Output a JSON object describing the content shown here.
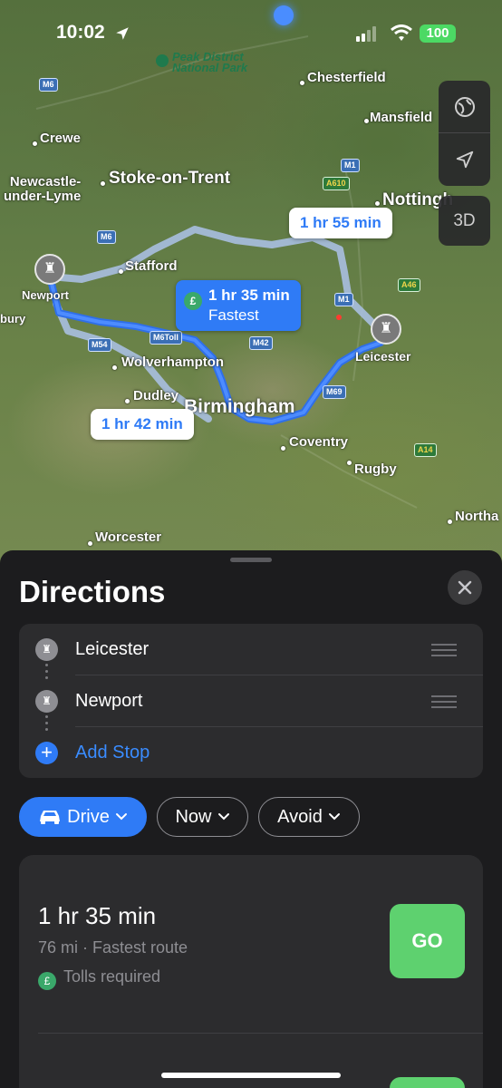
{
  "status": {
    "time": "10:02",
    "battery": "100"
  },
  "map": {
    "park_label": "Peak District\nNational Park",
    "places": {
      "chesterfield": "Chesterfield",
      "mansfield": "Mansfield",
      "crewe": "Crewe",
      "newcastle": "Newcastle-\nunder-Lyme",
      "stoke": "Stoke-on-Trent",
      "nottingham": "Nottingh",
      "stafford": "Stafford",
      "newport": "Newport",
      "bury": "bury",
      "leicester": "Leicester",
      "wolverhampton": "Wolverhampton",
      "dudley": "Dudley",
      "birmingham": "Birmingham",
      "coventry": "Coventry",
      "rugby": "Rugby",
      "northampton": "Northa",
      "worcester": "Worcester"
    },
    "roads": {
      "m6_top": "M6",
      "m1_top": "M1",
      "a610": "A610",
      "m6_mid": "M6",
      "m1_mid": "M1",
      "a46": "A46",
      "m54": "M54",
      "m6toll": "M6Toll",
      "m42": "M42",
      "m69": "M69",
      "a14": "A14"
    },
    "callouts": {
      "route_top": "1 hr 55 min",
      "route_fast_time": "1 hr 35 min",
      "route_fast_sub": "Fastest",
      "route_bottom": "1 hr 42 min",
      "toll_symbol": "£"
    },
    "controls": {
      "three_d": "3D"
    }
  },
  "sheet": {
    "title": "Directions",
    "stops": [
      {
        "label": "Leicester"
      },
      {
        "label": "Newport"
      }
    ],
    "add_stop": "Add Stop",
    "modes": {
      "drive": "Drive",
      "now": "Now",
      "avoid": "Avoid"
    },
    "route": {
      "time": "1 hr 35 min",
      "meta": "76 mi · Fastest route",
      "tolls": "Tolls required",
      "toll_symbol": "£",
      "go": "GO"
    }
  }
}
